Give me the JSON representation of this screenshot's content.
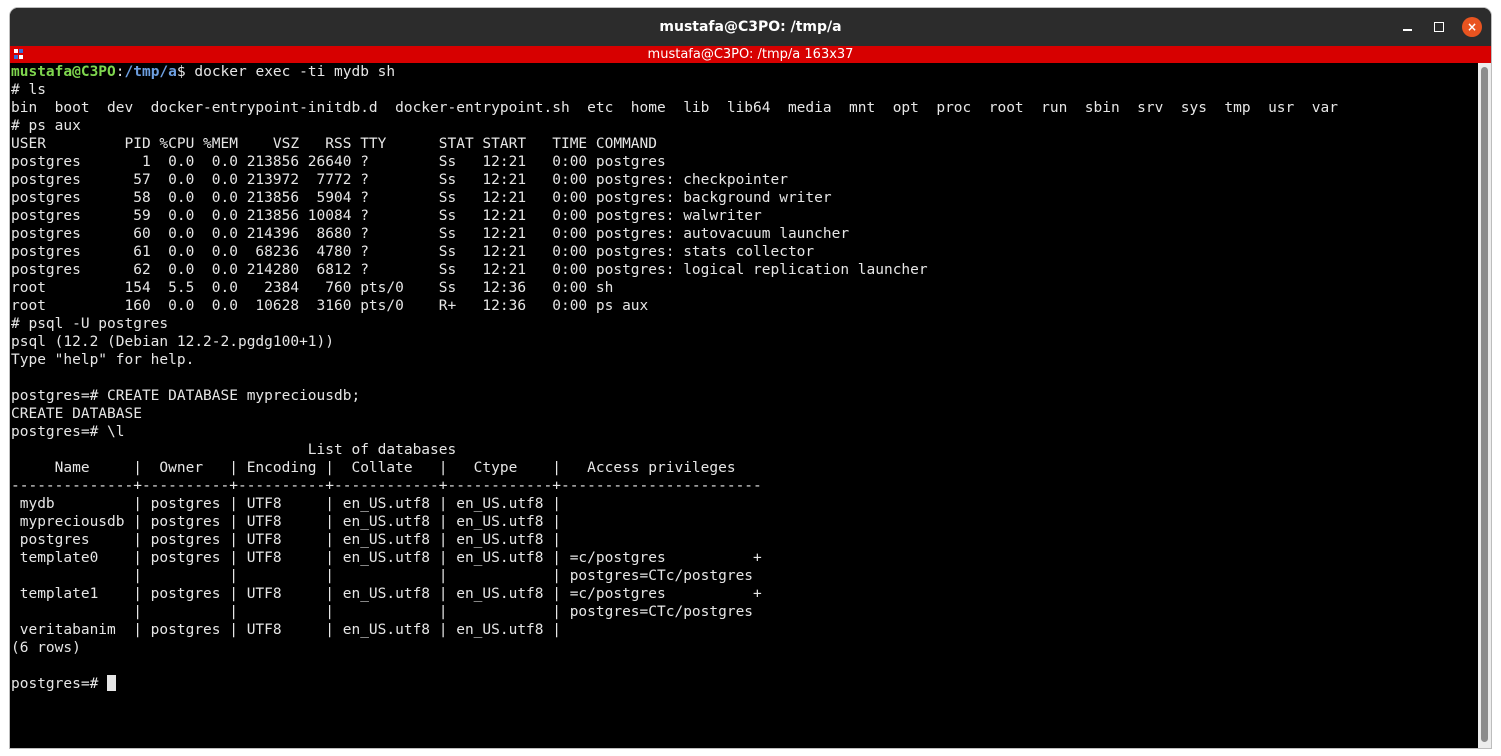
{
  "window": {
    "title": "mustafa@C3PO: /tmp/a",
    "info_bar": "mustafa@C3PO: /tmp/a 163x37",
    "controls": {
      "minimize": "minimize",
      "maximize": "maximize",
      "close": "×"
    },
    "close_color": "#e95420",
    "info_bar_color": "#d70000"
  },
  "terminal": {
    "prompt": {
      "user": "mustafa@C3PO",
      "sep": ":",
      "path": "/tmp/a",
      "symbol": "$",
      "command": " docker exec -ti mydb sh"
    },
    "lines": [
      "# ls",
      "bin  boot  dev  docker-entrypoint-initdb.d  docker-entrypoint.sh  etc  home  lib  lib64  media  mnt  opt  proc  root  run  sbin  srv  sys  tmp  usr  var",
      "# ps aux",
      "USER         PID %CPU %MEM    VSZ   RSS TTY      STAT START   TIME COMMAND",
      "postgres       1  0.0  0.0 213856 26640 ?        Ss   12:21   0:00 postgres",
      "postgres      57  0.0  0.0 213972  7772 ?        Ss   12:21   0:00 postgres: checkpointer",
      "postgres      58  0.0  0.0 213856  5904 ?        Ss   12:21   0:00 postgres: background writer",
      "postgres      59  0.0  0.0 213856 10084 ?        Ss   12:21   0:00 postgres: walwriter",
      "postgres      60  0.0  0.0 214396  8680 ?        Ss   12:21   0:00 postgres: autovacuum launcher",
      "postgres      61  0.0  0.0  68236  4780 ?        Ss   12:21   0:00 postgres: stats collector",
      "postgres      62  0.0  0.0 214280  6812 ?        Ss   12:21   0:00 postgres: logical replication launcher",
      "root         154  5.5  0.0   2384   760 pts/0    Ss   12:36   0:00 sh",
      "root         160  0.0  0.0  10628  3160 pts/0    R+   12:36   0:00 ps aux",
      "# psql -U postgres",
      "psql (12.2 (Debian 12.2-2.pgdg100+1))",
      "Type \"help\" for help.",
      "",
      "postgres=# CREATE DATABASE mypreciousdb;",
      "CREATE DATABASE",
      "postgres=# \\l",
      "                                  List of databases",
      "     Name     |  Owner   | Encoding |  Collate   |   Ctype    |   Access privileges",
      "--------------+----------+----------+------------+------------+-----------------------",
      " mydb         | postgres | UTF8     | en_US.utf8 | en_US.utf8 |",
      " mypreciousdb | postgres | UTF8     | en_US.utf8 | en_US.utf8 |",
      " postgres     | postgres | UTF8     | en_US.utf8 | en_US.utf8 |",
      " template0    | postgres | UTF8     | en_US.utf8 | en_US.utf8 | =c/postgres          +",
      "              |          |          |            |            | postgres=CTc/postgres",
      " template1    | postgres | UTF8     | en_US.utf8 | en_US.utf8 | =c/postgres          +",
      "              |          |          |            |            | postgres=CTc/postgres",
      " veritabanim  | postgres | UTF8     | en_US.utf8 | en_US.utf8 |",
      "(6 rows)",
      ""
    ],
    "final_prompt": "postgres=# ",
    "colors": {
      "user": "#7fd64e",
      "path": "#6d9fe0",
      "text": "#e6e6e6",
      "background": "#000000"
    }
  }
}
